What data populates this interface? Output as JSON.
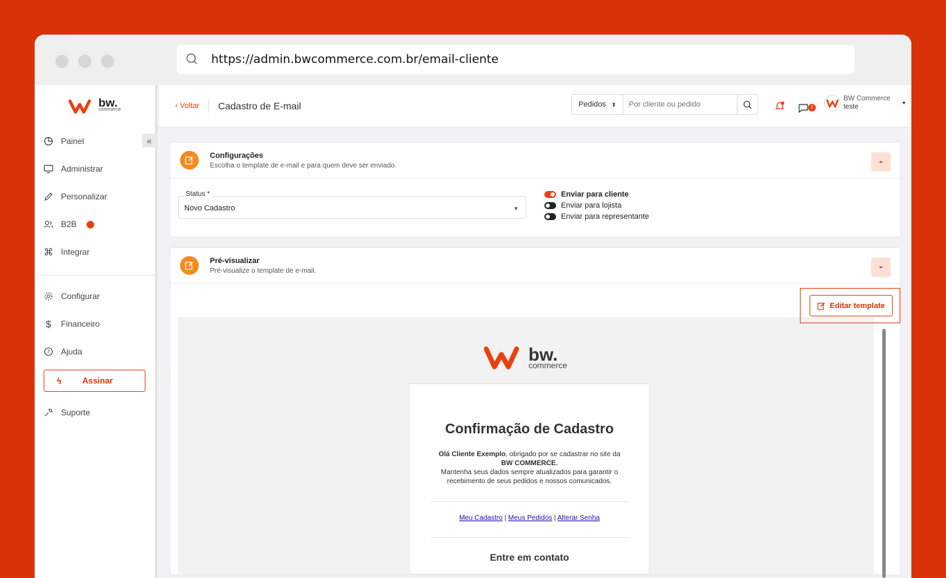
{
  "browser": {
    "url": "https://admin.bwcommerce.com.br/email-cliente"
  },
  "sidebar": {
    "logo_text": "bw.",
    "logo_sub": "commerce",
    "items_top": [
      {
        "label": "Painel",
        "icon": "clock-icon"
      },
      {
        "label": "Administrar",
        "icon": "monitor-icon"
      },
      {
        "label": "Personalizar",
        "icon": "pencil-icon"
      },
      {
        "label": "B2B",
        "icon": "users-icon"
      },
      {
        "label": "Integrar",
        "icon": "command-icon"
      }
    ],
    "items_bottom": [
      {
        "label": "Configurar",
        "icon": "gear-icon"
      },
      {
        "label": "Financeiro",
        "icon": "dollar-icon"
      },
      {
        "label": "Ajuda",
        "icon": "help-icon"
      }
    ],
    "assinar_label": "Assinar",
    "suporte_label": "Suporte",
    "collapse_label": "«"
  },
  "topbar": {
    "back_label": "‹ Voltar",
    "title": "Cadastro de E-mail",
    "search_select": "Pedidos",
    "search_placeholder": "Por cliente ou pedido",
    "messages_badge": "2",
    "user_name": "BW Commerce",
    "user_store": "teste"
  },
  "config_card": {
    "title": "Configurações",
    "subtitle": "Escolha o template de e-mail e para quem deve ser enviado.",
    "collapse_label": "-",
    "status_label": "Status *",
    "status_value": "Novo Cadastro",
    "toggles": [
      {
        "label": "Enviar para cliente",
        "on": true
      },
      {
        "label": "Enviar para lojista",
        "on": false
      },
      {
        "label": "Enviar para representante",
        "on": false
      }
    ]
  },
  "preview_card": {
    "title": "Pré-visualizar",
    "subtitle": "Pré-visualize o template de e-mail.",
    "collapse_label": "-",
    "edit_label": "Editar template"
  },
  "email": {
    "logo_text": "bw.",
    "logo_sub": "commerce",
    "heading": "Confirmação de Cadastro",
    "greeting_bold": "Olá Cliente Exemplo",
    "greeting_rest": ", obrigado por se cadastrar no site da",
    "brand": "BW COMMERCE.",
    "line2": "Mantenha seus dados sempre atualizados para garantir o",
    "line3": "recebimento de seus pedidos e nossos comunicados.",
    "links": [
      "Meu Cadastro",
      "Meus Pedidos",
      "Alterar Senha"
    ],
    "link_sep": " | ",
    "contact_heading": "Entre em contato"
  },
  "colors": {
    "brand_orange": "#e8410e",
    "background": "#d93209",
    "icon_orange": "#f58a1f"
  }
}
